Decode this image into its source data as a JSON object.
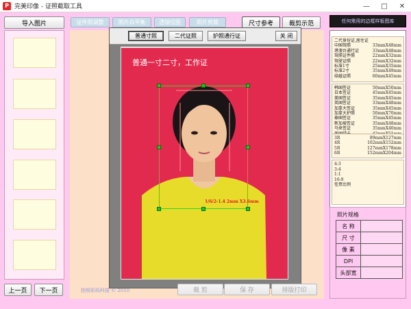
{
  "window": {
    "title": "完美印像 - 证照截取工具",
    "icon_letter": "P",
    "minimize": "—",
    "maximize": "□",
    "close": "✕"
  },
  "toolbar": {
    "import_label": "导入图片",
    "dim_tabs": [
      "证件照调整",
      "照片白平衡",
      "透镜位图",
      "照片剪裁"
    ],
    "size_ref_label": "尺寸参考",
    "crop_demo_label": "裁剪示范"
  },
  "right_header": "任何需用的边框样板图库",
  "dialog": {
    "tab1": "普通寸照",
    "tab2": "二代证照",
    "tab3": "护照通行证",
    "close_label": "关 闭",
    "caption": "普通一寸二寸，工作证",
    "size_label": "1/6/2-1.4 2mm X3.6mm"
  },
  "size_groups": [
    {
      "rows": [
        {
          "name": "二代身份证,居住证",
          "size": ""
        },
        {
          "name": "中国驾照",
          "size": "33mmX48mm"
        },
        {
          "name": "港澳台通行证",
          "size": "33mmX48mm"
        },
        {
          "name": "驾照证件照",
          "size": "22mmX32mm"
        },
        {
          "name": "驾驶证照",
          "size": "22mmX32mm"
        },
        {
          "name": "标准1寸",
          "size": "25mmX35mm"
        },
        {
          "name": "标准2寸",
          "size": "35mmX49mm"
        },
        {
          "name": "结婚证照",
          "size": "60mmX45mm"
        }
      ]
    },
    {
      "rows": [
        {
          "name": "韩国签证",
          "size": "50mmX50mm"
        },
        {
          "name": "日本签证",
          "size": "45mmX45mm"
        },
        {
          "name": "美国签证",
          "size": "35mmX45mm"
        },
        {
          "name": "英国签证",
          "size": "33mmX48mm"
        },
        {
          "name": "加拿大签证",
          "size": "35mmX45mm"
        },
        {
          "name": "加拿大护照",
          "size": "50mmX70mm"
        },
        {
          "name": "泰国签证",
          "size": "35mmX45mm"
        },
        {
          "name": "新加坡签证",
          "size": "35mmX48mm"
        },
        {
          "name": "马来签证",
          "size": "35mmX40mm"
        },
        {
          "name": "美国绿卡",
          "size": "42mmX51mm"
        }
      ]
    },
    {
      "rows": [
        {
          "name": "3R",
          "size": "89mmX127mm"
        },
        {
          "name": "4R",
          "size": "102mmX152mm"
        },
        {
          "name": "5R",
          "size": "127mmX178mm"
        },
        {
          "name": "6R",
          "size": "152mmX204mm"
        }
      ]
    }
  ],
  "ratios": [
    "4:3",
    "3:4",
    "1:1",
    "16:9",
    "任意比例"
  ],
  "spec": {
    "title": "照片规格",
    "rows": [
      {
        "label": "名 称",
        "value": ""
      },
      {
        "label": "尺 寸",
        "value": ""
      },
      {
        "label": "像 素",
        "value": ""
      },
      {
        "label": "DPI",
        "value": ""
      },
      {
        "label": "头部宽",
        "value": ""
      }
    ]
  },
  "bottom": {
    "prev_label": "上一页",
    "next_label": "下一页",
    "crop_label": "裁 剪",
    "save_label": "保 存",
    "print_label": "排版打印",
    "watermark": "拍照彩码科技 © 2010"
  }
}
